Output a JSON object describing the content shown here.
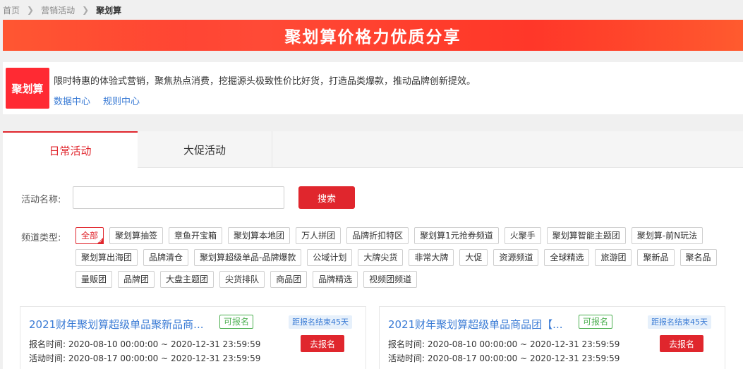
{
  "breadcrumb": {
    "items": [
      "首页",
      "营销活动"
    ],
    "current": "聚划算"
  },
  "banner": {
    "title": "聚划算价格力优质分享"
  },
  "intro": {
    "logo_text": "聚划算",
    "description": "限时特惠的体验式营销，聚焦热点消费，挖掘源头极致性价比好货，打造品类爆款，推动品牌创新提效。",
    "links": [
      "数据中心",
      "规则中心"
    ]
  },
  "tabs": [
    {
      "label": "日常活动",
      "active": true
    },
    {
      "label": "大促活动",
      "active": false
    }
  ],
  "search": {
    "label": "活动名称:",
    "value": "",
    "placeholder": "",
    "button": "搜索"
  },
  "channel": {
    "label": "频道类型:",
    "selected": "全部",
    "tags": [
      "全部",
      "聚划算抽签",
      "章鱼开宝箱",
      "聚划算本地团",
      "万人拼团",
      "品牌折扣特区",
      "聚划算1元抢券频道",
      "火聚手",
      "聚划算智能主题团",
      "聚划算-前N玩法",
      "聚划算出海团",
      "品牌清仓",
      "聚划算超级单品-品牌爆款",
      "公域计划",
      "大牌尖货",
      "非常大牌",
      "大促",
      "资源频道",
      "全球精选",
      "旅游团",
      "聚新品",
      "聚名品",
      "量贩团",
      "品牌团",
      "大盘主题团",
      "尖货排队",
      "商品团",
      "品牌精选",
      "视频团频道"
    ]
  },
  "cards": [
    {
      "title": "2021财年聚划算超级单品聚新品商...",
      "status": "可报名",
      "countdown": "距报名结束45天",
      "signup_time": "报名时间:  2020-08-10 00:00:00 ~ 2020-12-31 23:59:59",
      "activity_time": "活动时间:  2020-08-17 00:00:00 ~ 2020-12-31 23:59:59",
      "button": "去报名"
    },
    {
      "title": "2021财年聚划算超级单品商品团【...",
      "status": "可报名",
      "countdown": "距报名结束45天",
      "signup_time": "报名时间:  2020-08-10 00:00:00 ~ 2020-12-31 23:59:59",
      "activity_time": "活动时间:  2020-08-17 00:00:00 ~ 2020-12-31 23:59:59",
      "button": "去报名"
    }
  ],
  "colors": {
    "accent": "#e0262d",
    "link": "#3a7bd5",
    "status_green": "#4caf50"
  }
}
